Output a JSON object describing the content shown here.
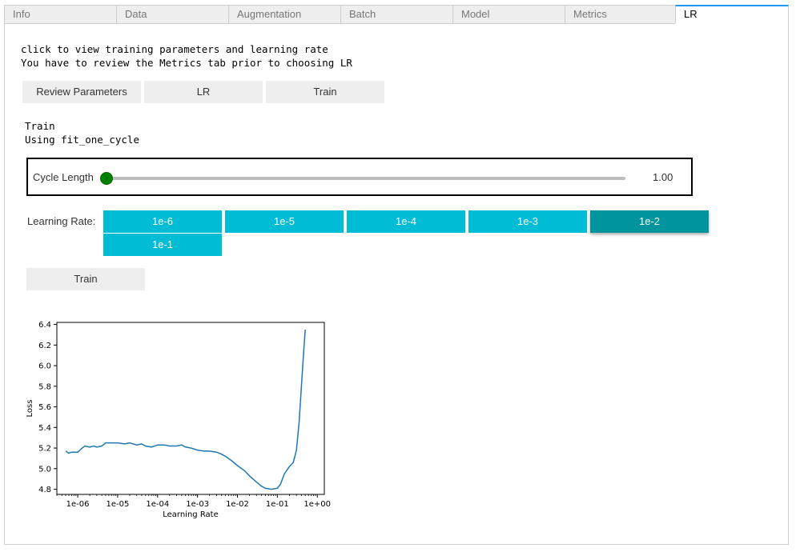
{
  "tabs": [
    {
      "label": "Info",
      "active": false
    },
    {
      "label": "Data",
      "active": false
    },
    {
      "label": "Augmentation",
      "active": false
    },
    {
      "label": "Batch",
      "active": false
    },
    {
      "label": "Model",
      "active": false
    },
    {
      "label": "Metrics",
      "active": false
    },
    {
      "label": "LR",
      "active": true
    }
  ],
  "intro": {
    "line1": "click to view training parameters and learning rate",
    "line2": "You have to review the Metrics tab prior to choosing LR"
  },
  "top_buttons": {
    "review": "Review Parameters",
    "lr": "LR",
    "train": "Train"
  },
  "status": {
    "line1": "Train",
    "line2": "Using fit_one_cycle"
  },
  "cycle_slider": {
    "label": "Cycle Length",
    "value_text": "1.00",
    "fraction": 0.0
  },
  "learning_rate": {
    "label": "Learning Rate:",
    "options": [
      "1e-6",
      "1e-5",
      "1e-4",
      "1e-3",
      "1e-2",
      "1e-1"
    ],
    "selected": "1e-2"
  },
  "train_button": "Train",
  "colors": {
    "accent": "#00bcd4",
    "accent_selected": "#00949f",
    "slider_handle": "#008000",
    "line": "#1f77b4",
    "tab_active_border": "#2196f3"
  },
  "chart_data": {
    "type": "line",
    "xscale": "log",
    "xlabel": "Learning Rate",
    "ylabel": "Loss",
    "xlim": [
      3e-07,
      1.5
    ],
    "ylim": [
      4.75,
      6.42
    ],
    "xticks": [
      "1e-06",
      "1e-05",
      "1e-04",
      "1e-03",
      "1e-02",
      "1e-01",
      "1e+00"
    ],
    "yticks": [
      "4.8",
      "5.0",
      "5.2",
      "5.4",
      "5.6",
      "5.8",
      "6.0",
      "6.2",
      "6.4"
    ],
    "x": [
      5e-07,
      6e-07,
      7e-07,
      8e-07,
      1e-06,
      1.2e-06,
      1.5e-06,
      2e-06,
      2.5e-06,
      3e-06,
      4e-06,
      5e-06,
      7e-06,
      1e-05,
      1.5e-05,
      2e-05,
      3e-05,
      4e-05,
      5e-05,
      7e-05,
      0.0001,
      0.00015,
      0.0002,
      0.0003,
      0.0004,
      0.0005,
      0.0007,
      0.001,
      0.0015,
      0.002,
      0.003,
      0.004,
      0.005,
      0.007,
      0.01,
      0.015,
      0.02,
      0.03,
      0.04,
      0.05,
      0.07,
      0.1,
      0.12,
      0.15,
      0.2,
      0.25,
      0.3,
      0.35,
      0.4,
      0.45,
      0.5
    ],
    "y": [
      5.17,
      5.15,
      5.16,
      5.16,
      5.16,
      5.19,
      5.22,
      5.21,
      5.22,
      5.21,
      5.22,
      5.25,
      5.25,
      5.25,
      5.24,
      5.25,
      5.23,
      5.24,
      5.22,
      5.21,
      5.23,
      5.23,
      5.22,
      5.22,
      5.23,
      5.21,
      5.2,
      5.18,
      5.17,
      5.17,
      5.16,
      5.14,
      5.12,
      5.08,
      5.03,
      4.98,
      4.93,
      4.87,
      4.83,
      4.81,
      4.8,
      4.81,
      4.85,
      4.95,
      5.02,
      5.06,
      5.18,
      5.45,
      5.8,
      6.1,
      6.35
    ]
  }
}
